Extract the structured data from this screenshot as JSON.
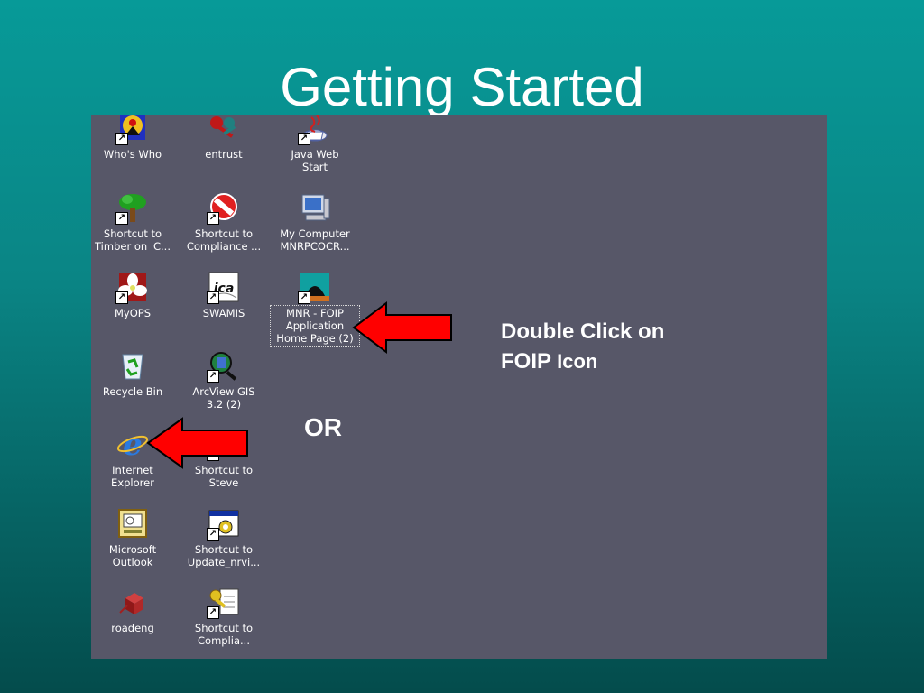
{
  "slide": {
    "title": "Getting Started",
    "callout_line1": "Double Click on",
    "callout_line2_strong": "FOIP",
    "callout_line2_rest": " Icon",
    "or_text": "OR"
  },
  "colors": {
    "desktop_bg": "#575768",
    "arrow_fill": "#ff0000",
    "slide_bg_top": "#079a98",
    "slide_bg_bottom": "#044c4c"
  },
  "desktop_icons": [
    {
      "label": "Who's Who",
      "icon": "whos-who-icon",
      "shortcut": true
    },
    {
      "label": "entrust",
      "icon": "keys-icon",
      "shortcut": false
    },
    {
      "label": "Java Web\nStart",
      "icon": "java-icon",
      "shortcut": true
    },
    {
      "label": "Shortcut to\nTimber on 'C...",
      "icon": "tree-icon",
      "shortcut": true
    },
    {
      "label": "Shortcut to\nCompliance ...",
      "icon": "no-entry-icon",
      "shortcut": true
    },
    {
      "label": "My Computer\nMNRPCOCR...",
      "icon": "computer-icon",
      "shortcut": false
    },
    {
      "label": "MyOPS",
      "icon": "trillium-icon",
      "shortcut": true
    },
    {
      "label": "SWAMIS",
      "icon": "ica-icon",
      "shortcut": true
    },
    {
      "label": "MNR - FOIP\nApplication\nHome Page (2)",
      "icon": "foip-icon",
      "shortcut": true
    },
    {
      "label": "Recycle Bin",
      "icon": "recycle-bin-icon",
      "shortcut": false
    },
    {
      "label": "ArcView GIS\n3.2 (2)",
      "icon": "arcview-icon",
      "shortcut": true
    },
    {
      "label": "Internet\nExplorer",
      "icon": "internet-explorer-icon",
      "shortcut": false
    },
    {
      "label": "Shortcut to\nSteve",
      "icon": "ie-shortcut-icon",
      "shortcut": true
    },
    {
      "label": "Microsoft\nOutlook",
      "icon": "outlook-icon",
      "shortcut": false
    },
    {
      "label": "Shortcut to\nUpdate_nrvi...",
      "icon": "update-window-icon",
      "shortcut": true
    },
    {
      "label": "roadeng",
      "icon": "roadeng-icon",
      "shortcut": false
    },
    {
      "label": "Shortcut to\nComplia...",
      "icon": "key-document-icon",
      "shortcut": true
    }
  ]
}
